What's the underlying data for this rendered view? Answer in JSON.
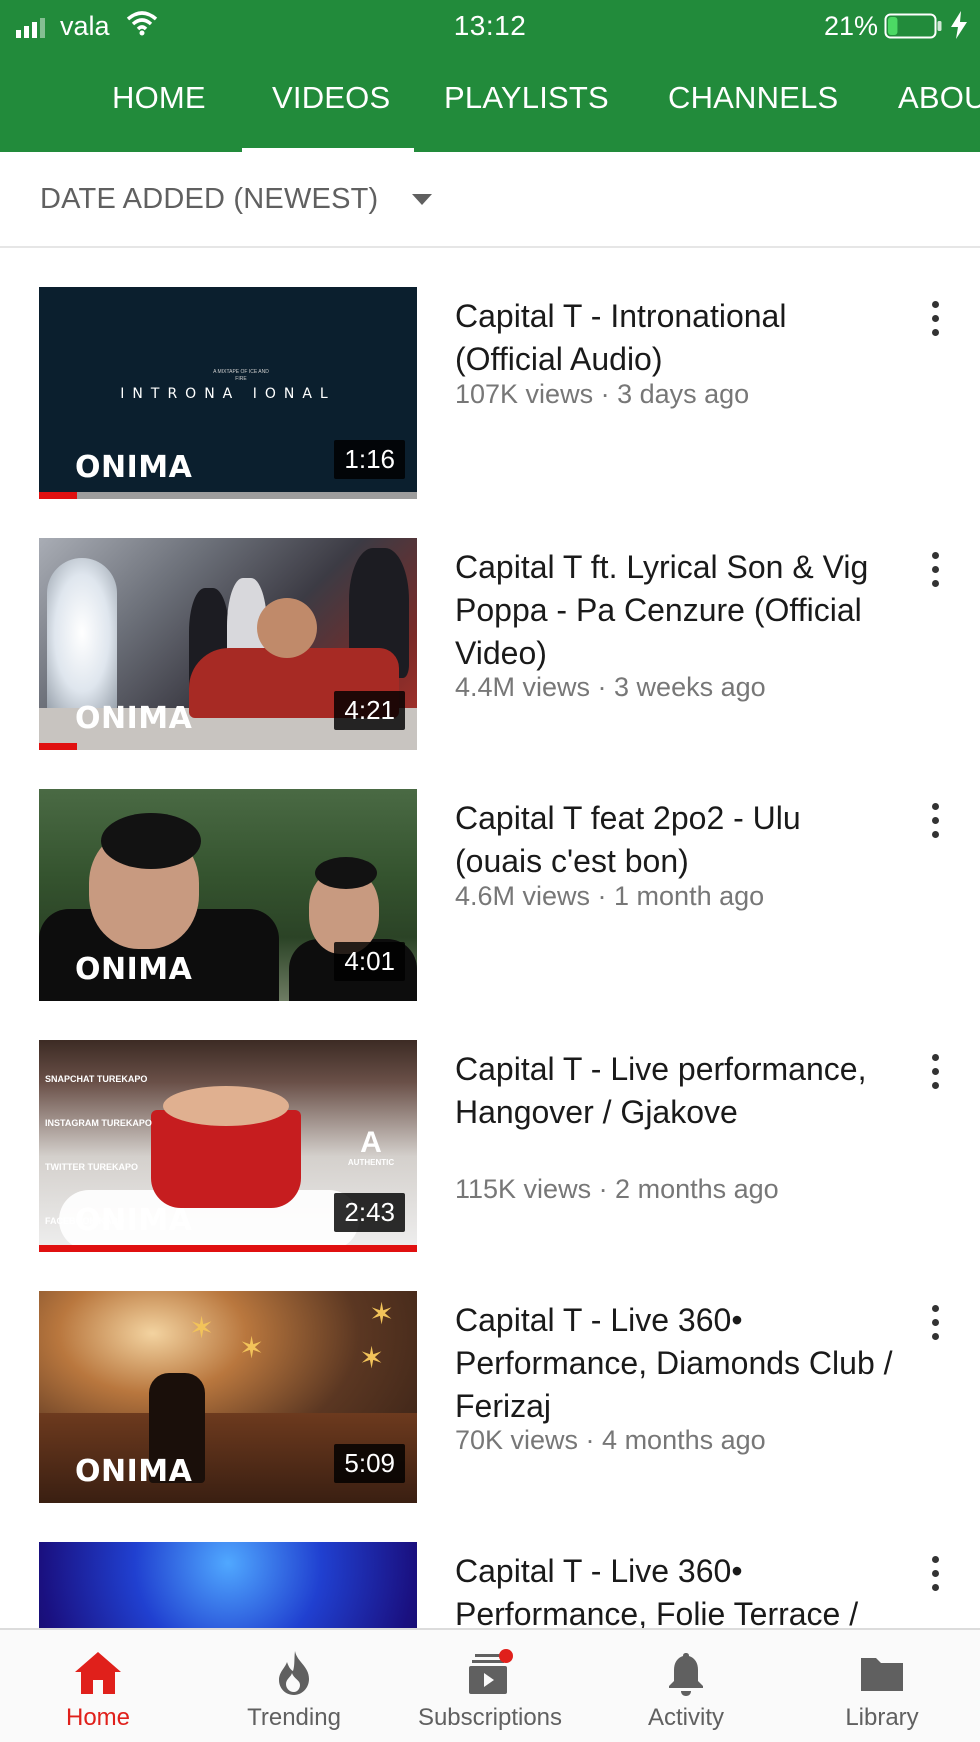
{
  "status_bar": {
    "carrier": "vala",
    "time": "13:12",
    "battery_percent": "21%",
    "battery_level": 0.21
  },
  "tabs": [
    {
      "label": "HOME"
    },
    {
      "label": "VIDEOS"
    },
    {
      "label": "PLAYLISTS"
    },
    {
      "label": "CHANNELS"
    },
    {
      "label": "ABOU"
    }
  ],
  "active_tab": "VIDEOS",
  "sort": {
    "label": "DATE ADDED (NEWEST)"
  },
  "thumb_logo": "ONIMA",
  "videos": [
    {
      "title": "Capital T - Intronational (Official Audio)",
      "meta": "107K views · 3 days ago",
      "duration": "1:16",
      "watched_fraction": 0.1,
      "thumb_text": "INTRONA      IONAL",
      "thumb_small": "A MIXTAPE OF ICE AND FIRE"
    },
    {
      "title": "Capital T ft. Lyrical Son & Vig Poppa - Pa Cenzure (Official Video)",
      "meta": "4.4M views · 3 weeks ago",
      "duration": "4:21",
      "watched_fraction": 0.1
    },
    {
      "title": "Capital T feat 2po2 - Ulu (ouais c'est bon)",
      "meta": "4.6M views · 1 month ago",
      "duration": "4:01"
    },
    {
      "title": "Capital T - Live performance, Hangover / Gjakove",
      "meta": "115K views · 2 months ago",
      "duration": "2:43",
      "watched_fraction": 1.0,
      "thumb_social": [
        "SNAPCHAT TUREKAPO",
        "INSTAGRAM TUREKAPO",
        "TWITTER TUREKAPO",
        "FACEBOOK KAPO"
      ],
      "thumb_brand": "AUTHENTIC"
    },
    {
      "title": "Capital T - Live 360• Performance, Diamonds Club / Ferizaj",
      "meta": "70K views · 4 months ago",
      "duration": "5:09"
    },
    {
      "title": "Capital T - Live 360• Performance, Folie Terrace /",
      "meta": "",
      "duration": ""
    }
  ],
  "bottom_nav": [
    {
      "label": "Home",
      "icon": "home-icon",
      "active": true
    },
    {
      "label": "Trending",
      "icon": "flame-icon",
      "active": false
    },
    {
      "label": "Subscriptions",
      "icon": "subscriptions-icon",
      "active": false
    },
    {
      "label": "Activity",
      "icon": "bell-icon",
      "active": false
    },
    {
      "label": "Library",
      "icon": "folder-icon",
      "active": false
    }
  ],
  "colors": {
    "header_green": "#228b3b",
    "accent_red": "#e0201b",
    "text_primary": "#1a1a1a",
    "text_secondary": "#777777"
  }
}
